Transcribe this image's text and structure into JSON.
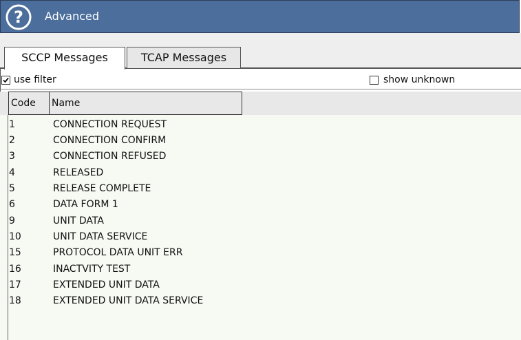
{
  "window": {
    "title": "Advanced",
    "help_icon": "help-icon"
  },
  "tabs": [
    {
      "label": "SCCP Messages",
      "active": true
    },
    {
      "label": "TCAP Messages",
      "active": false
    }
  ],
  "filters": {
    "use_filter": {
      "label": "use filter",
      "checked": true
    },
    "show_unknown": {
      "label": "show unknown",
      "checked": false
    }
  },
  "table": {
    "columns": [
      "Code",
      "Name"
    ],
    "rows": [
      {
        "code": "1",
        "name": "CONNECTION REQUEST"
      },
      {
        "code": "2",
        "name": "CONNECTION CONFIRM"
      },
      {
        "code": "3",
        "name": "CONNECTION REFUSED"
      },
      {
        "code": "4",
        "name": "RELEASED"
      },
      {
        "code": "5",
        "name": "RELEASE COMPLETE"
      },
      {
        "code": "6",
        "name": "DATA FORM 1"
      },
      {
        "code": "9",
        "name": "UNIT DATA"
      },
      {
        "code": "10",
        "name": "UNIT DATA SERVICE"
      },
      {
        "code": "15",
        "name": "PROTOCOL DATA UNIT ERR"
      },
      {
        "code": "16",
        "name": "INACTVITY TEST"
      },
      {
        "code": "17",
        "name": "EXTENDED UNIT DATA"
      },
      {
        "code": "18",
        "name": "EXTENDED UNIT DATA SERVICE"
      }
    ]
  },
  "colors": {
    "titlebar": "#4b6e9c",
    "table_background": "#f6faf3"
  }
}
